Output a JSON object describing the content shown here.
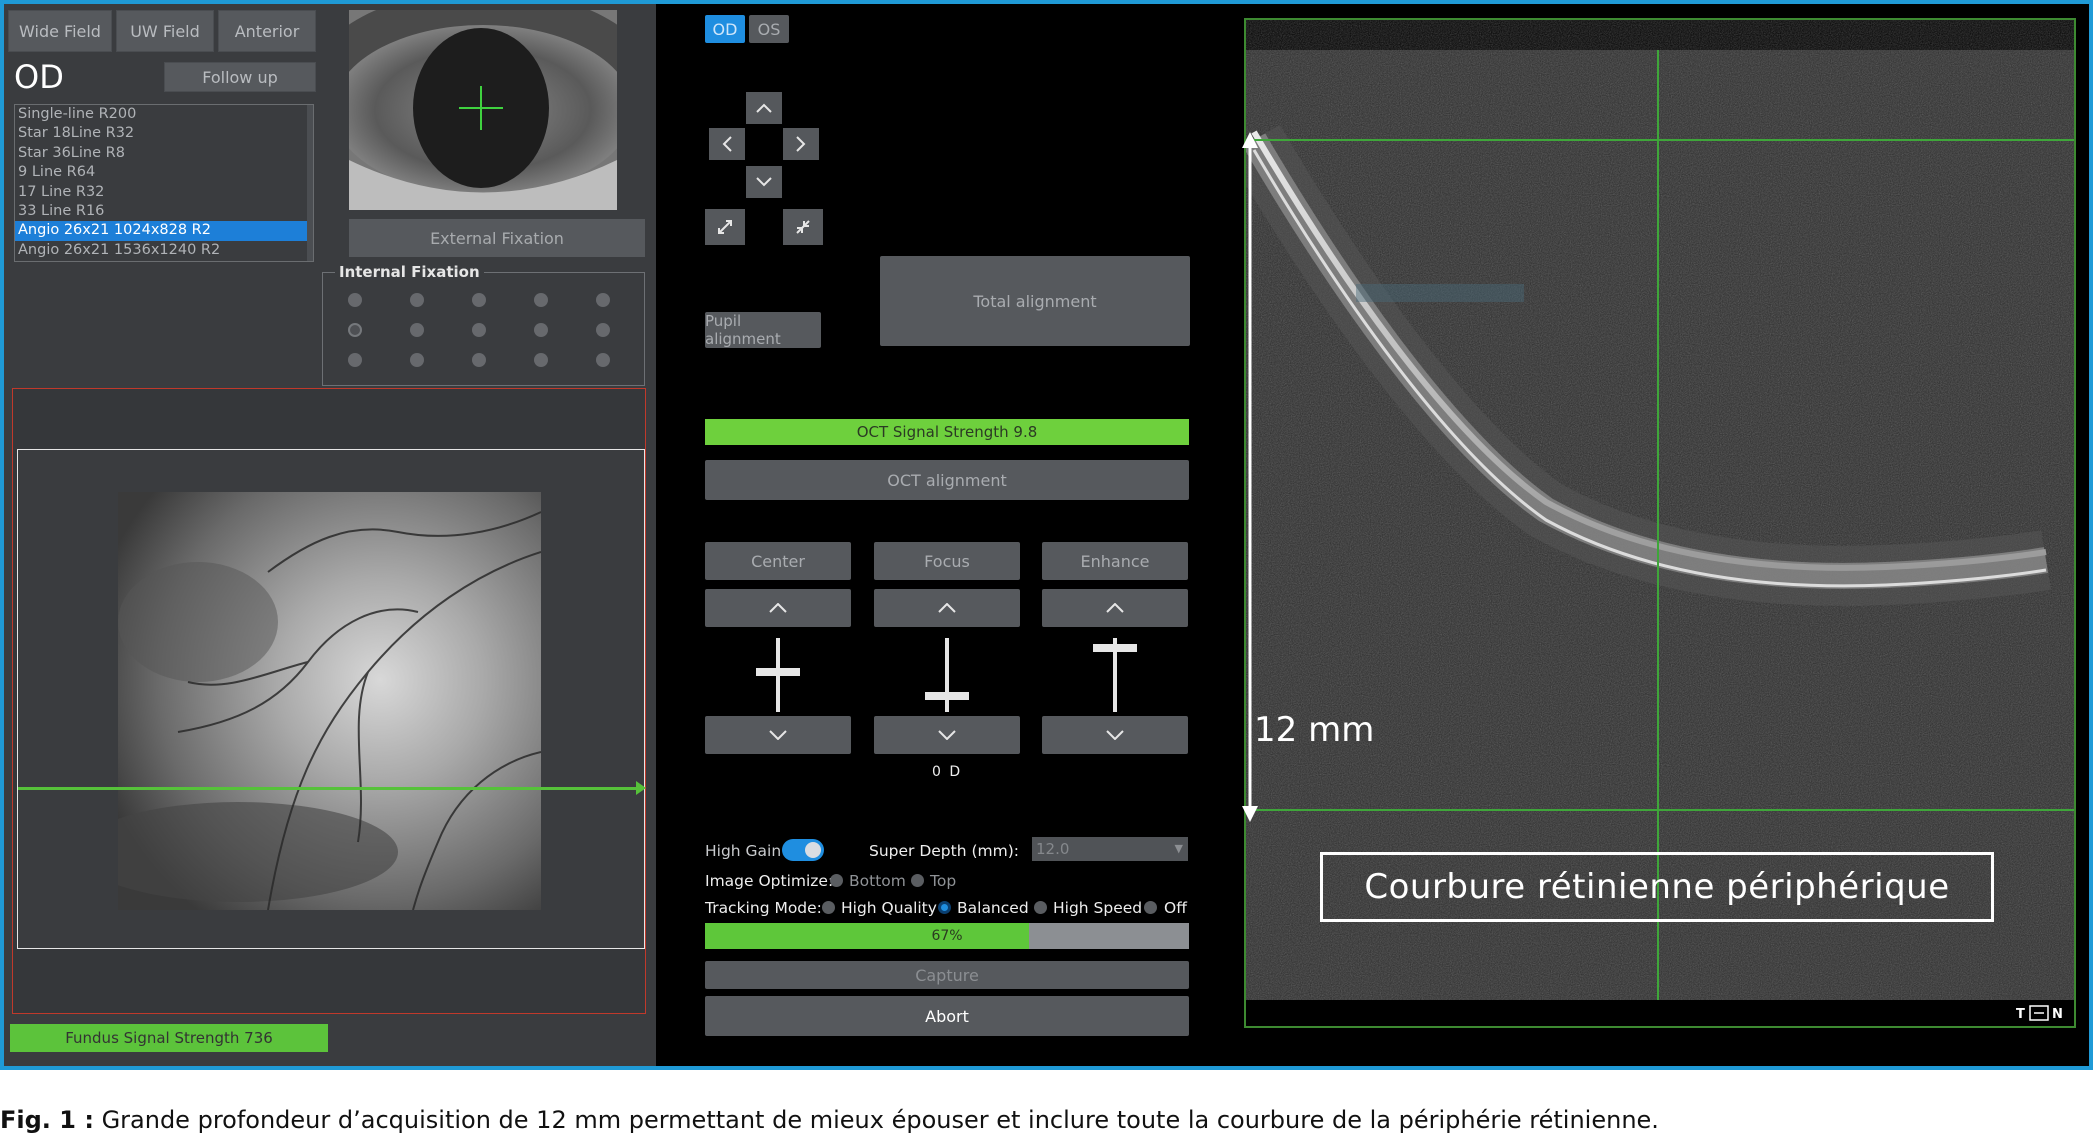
{
  "left": {
    "tabs": [
      "Wide Field",
      "UW Field",
      "Anterior"
    ],
    "eye_label": "OD",
    "follow_up": "Follow up",
    "scan_protocols": [
      "Single-line R200",
      "Star 18Line R32",
      "Star 36Line R8",
      "9 Line R64",
      "17 Line R32",
      "33 Line R16",
      "Angio 26x21 1024x828 R2",
      "Angio 26x21 1536x1240 R2"
    ],
    "selected_protocol": "Angio 26x21 1024x828 R2",
    "external_fixation": "External Fixation",
    "internal_fixation": "Internal Fixation",
    "fundus_signal": "Fundus Signal Strength 736"
  },
  "mid": {
    "eye_buttons": [
      "OD",
      "OS"
    ],
    "selected_eye": "OD",
    "pupil_alignment": "Pupil alignment",
    "total_alignment": "Total alignment",
    "oct_signal": "OCT Signal Strength 9.8",
    "oct_signal_value": 9.8,
    "oct_alignment": "OCT alignment",
    "controls": [
      "Center",
      "Focus",
      "Enhance"
    ],
    "eye_indicator": "0 D",
    "high_gain_label": "High Gain",
    "high_gain_on": true,
    "super_depth_label": "Super Depth (mm):",
    "super_depth_value": "12.0",
    "image_optimize_label": "Image Optimize:",
    "image_optimize_options": [
      "Bottom",
      "Top"
    ],
    "tracking_mode_label": "Tracking Mode:",
    "tracking_options": [
      "High Quality",
      "Balanced",
      "High Speed",
      "Off"
    ],
    "tracking_selected": "Balanced",
    "progress_text": "67%",
    "progress_value": 0.67,
    "capture": "Capture",
    "abort": "Abort"
  },
  "right": {
    "depth_label": "12 mm",
    "caption": "Courbure rétinienne périphérique",
    "orientation": {
      "left": "T",
      "right": "N"
    }
  },
  "figure_caption": {
    "prefix": "Fig. 1 :",
    "text": " Grande profondeur d’acquisition de 12 mm permettant de mieux épouser et inclure toute la courbure de la périphérie rétinienne."
  },
  "colors": {
    "accent_blue": "#1f8ee0",
    "signal_green": "#6ed03d",
    "guide_green": "#3d8a31",
    "frame_red": "#c0392b"
  }
}
